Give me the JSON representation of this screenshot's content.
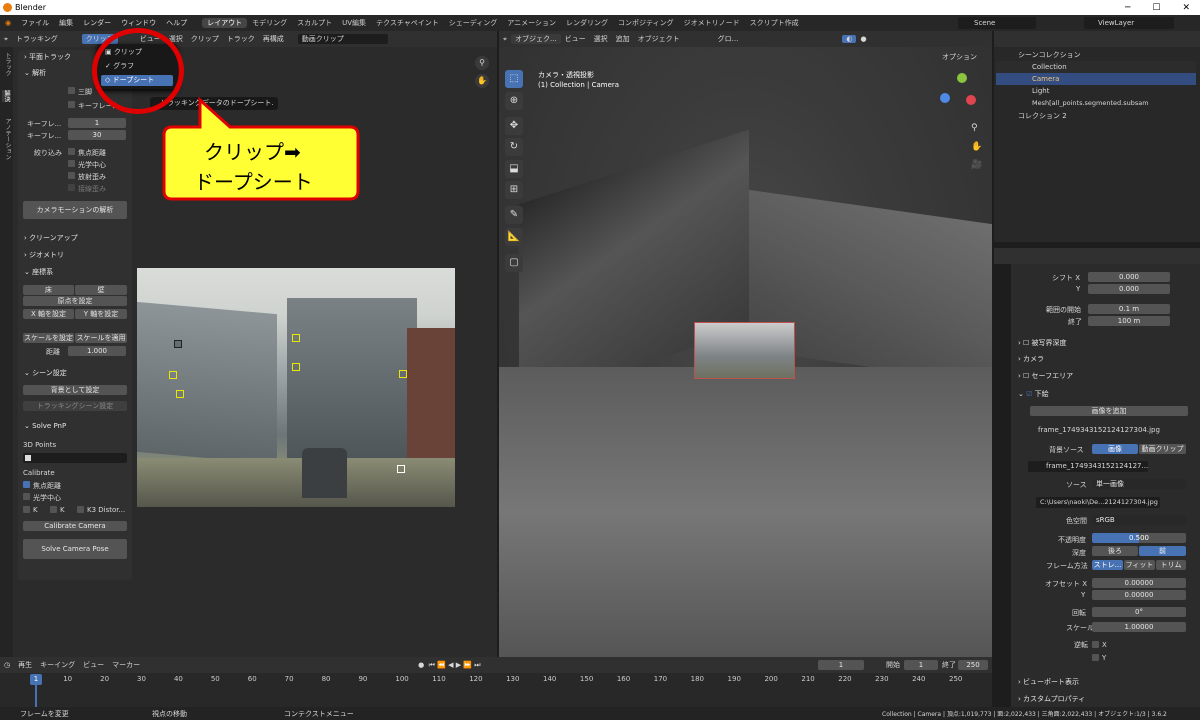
{
  "window": {
    "title": "Blender",
    "minimize": "─",
    "maximize": "☐",
    "close": "✕"
  },
  "menu": {
    "items": [
      "ファイル",
      "編集",
      "レンダー",
      "ウィンドウ",
      "ヘルプ"
    ],
    "workspaces": [
      "レイアウト",
      "モデリング",
      "スカルプト",
      "UV編集",
      "テクスチャペイント",
      "シェーディング",
      "アニメーション",
      "レンダリング",
      "コンポジティング",
      "ジオメトリノード",
      "スクリプト作成"
    ],
    "scene": "Scene",
    "viewlayer": "ViewLayer"
  },
  "clip_editor": {
    "mode": "トラッキング",
    "view": "クリップ",
    "view_menu": "ビュー",
    "menus": [
      "選択",
      "クリップ",
      "トラック",
      "再構成"
    ],
    "clip_name": "動画クリップ",
    "dropdown": {
      "items": [
        "クリップ",
        "グラフ",
        "ドープシート"
      ],
      "tooltip": "トラッキングデータのドープシート."
    },
    "tabs": [
      "トラック",
      "解決",
      "アノテーション"
    ],
    "panel": {
      "plane_track": "平面トラック",
      "solve": "解析",
      "tripod": "三脚",
      "keyframe": "キーフレーム",
      "kf_a_label": "キーフレ...",
      "kf_a": "1",
      "kf_b_label": "キーフレ...",
      "kf_b": "30",
      "refine": "絞り込み",
      "focal": "焦点距離",
      "optical": "光学中心",
      "radial": "放射歪み",
      "tangential": "接線歪み",
      "solve_btn": "カメラモーションの解析",
      "cleanup": "クリーンアップ",
      "geometry": "ジオメトリ",
      "orient": "座標系",
      "floor": "床",
      "wall": "壁",
      "origin": "原点を設定",
      "xaxis": "X 軸を設定",
      "yaxis": "Y 軸を設定",
      "scale_set": "スケールを設定",
      "scale_apply": "スケールを適用",
      "distance": "距離",
      "distance_val": "1.000",
      "scene_setup": "シーン設定",
      "set_bg": "背景として設定",
      "setup_track": "トラッキングシーン設定",
      "pnp": "Solve PnP",
      "points_3d": "3D Points",
      "calibrate": "Calibrate",
      "cal_focal": "焦点距離",
      "cal_optical": "光学中心",
      "k1": "K",
      "k2": "K",
      "k3": "K3 Distor...",
      "cal_btn": "Calibrate Camera",
      "pose_btn": "Solve Camera Pose"
    }
  },
  "annotation": {
    "line1": "クリップ➡",
    "line2": "ドープシート"
  },
  "viewport": {
    "mode": "オブジェク...",
    "menus": [
      "ビュー",
      "選択",
      "追加",
      "オブジェクト"
    ],
    "transform": "グロ...",
    "options": "オプション",
    "info1": "カメラ・透視投影",
    "info2": "(1) Collection | Camera"
  },
  "outliner": {
    "rows": [
      "シーンコレクション",
      "Collection",
      "Camera",
      "Light",
      "Mesh[all_points.segmented.subsam",
      "コレクション 2"
    ]
  },
  "props": {
    "shift_x_label": "シフト X",
    "shift_x": "0.000",
    "y_label": "Y",
    "shift_y": "0.000",
    "clip_start_label": "範囲の開始",
    "clip_start": "0.1 m",
    "clip_end_label": "終了",
    "clip_end": "100 m",
    "dof": "被写界深度",
    "camera": "カメラ",
    "safe": "セーフエリア",
    "bg": "下絵",
    "add_image": "画像を追加",
    "frame_name": "frame_1749343152124127304.jpg",
    "bg_source_label": "背景ソース",
    "image": "画像",
    "movie_clip": "動画クリップ",
    "img_block": "frame_1749343152124127...",
    "source_label": "ソース",
    "source_val": "単一画像",
    "path": "C:\\Users\\naoki\\De...2124127304.jpg",
    "colorspace_label": "色空間",
    "colorspace": "sRGB",
    "opacity_label": "不透明度",
    "opacity": "0.500",
    "depth_label": "深度",
    "back": "後ろ",
    "front": "前",
    "frame_method_label": "フレーム方法",
    "stretch": "ストレ...",
    "fit": "フィット",
    "crop": "トリム",
    "offset_x_label": "オフセット X",
    "offset_x": "0.00000",
    "offset_y_label": "Y",
    "offset_y": "0.00000",
    "rotation_label": "回転",
    "rotation": "0°",
    "scale_label": "スケール",
    "scale": "1.00000",
    "flip_label": "逆転",
    "flip_x": "X",
    "flip_y": "Y",
    "viewport_display": "ビューポート表示",
    "custom_props": "カスタムプロパティ"
  },
  "timeline": {
    "menus": [
      "再生",
      "キーイング",
      "ビュー",
      "マーカー"
    ],
    "current": "1",
    "start_label": "開始",
    "start": "1",
    "end_label": "終了",
    "end": "250",
    "ticks": [
      "1",
      "10",
      "20",
      "30",
      "40",
      "50",
      "60",
      "70",
      "80",
      "90",
      "100",
      "110",
      "120",
      "130",
      "140",
      "150",
      "160",
      "170",
      "180",
      "190",
      "200",
      "210",
      "220",
      "230",
      "240",
      "250"
    ]
  },
  "status": {
    "left": "フレームを変更",
    "mid": "視点の移動",
    "ctx": "コンテクストメニュー",
    "right": "Collection | Camera | 頂点:1,019,773 | 面:2,022,433 | 三角面:2,022,433 | オブジェクト:1/3 | 3.6.2"
  },
  "colors": {
    "accent": "#4772b3",
    "annotation_red": "#e00000",
    "annotation_fill": "#ffff33",
    "marker": "#e8e800"
  }
}
